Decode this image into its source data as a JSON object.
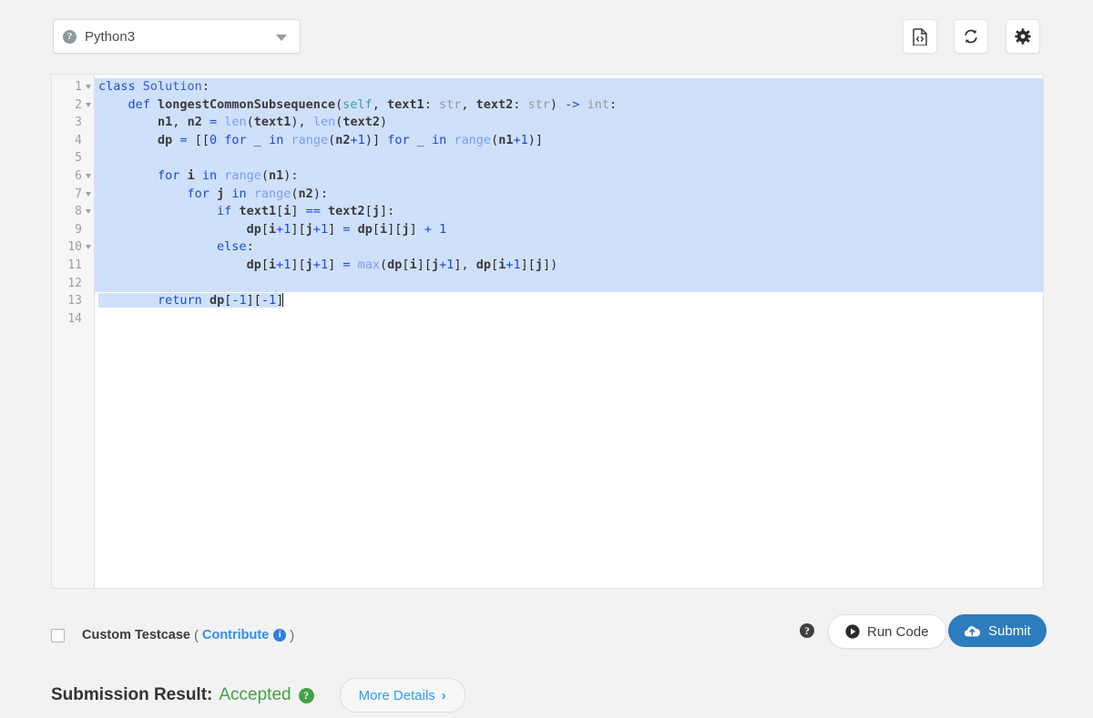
{
  "toolbar": {
    "language": "Python3",
    "language_icon": "help-circle-icon",
    "buttons": [
      {
        "name": "code-snippet-button",
        "icon": "code-file-icon"
      },
      {
        "name": "reset-button",
        "icon": "refresh-icon"
      },
      {
        "name": "settings-button",
        "icon": "gear-icon"
      }
    ]
  },
  "editor": {
    "line_numbers": [
      "1",
      "2",
      "3",
      "4",
      "5",
      "6",
      "7",
      "8",
      "9",
      "10",
      "11",
      "12",
      "13",
      "14"
    ],
    "folded_lines": [
      1,
      2,
      6,
      7,
      8,
      10
    ],
    "selection_color": "#cfe0fb",
    "code_lines": [
      "class Solution:",
      "    def longestCommonSubsequence(self, text1: str, text2: str) -> int:",
      "        n1, n2 = len(text1), len(text2)",
      "        dp = [[0 for _ in range(n2+1)] for _ in range(n1+1)]",
      "",
      "        for i in range(n1):",
      "            for j in range(n2):",
      "                if text1[i] == text2[j]:",
      "                    dp[i+1][j+1] = dp[i][j] + 1",
      "                else:",
      "                    dp[i+1][j+1] = max(dp[i][j+1], dp[i+1][j])",
      "",
      "        return dp[-1][-1]",
      ""
    ]
  },
  "testcase": {
    "checkbox_checked": false,
    "label": "Custom Testcase",
    "open_paren": "(",
    "contribute_label": "Contribute",
    "contribute_icon": "info-icon",
    "close_paren": ")"
  },
  "actions": {
    "help_icon": "help-circle-icon",
    "run_label": "Run Code",
    "run_icon": "play-icon",
    "submit_label": "Submit",
    "submit_icon": "cloud-upload-icon",
    "submit_color": "#2d7cbd"
  },
  "result": {
    "title": "Submission Result:",
    "status": "Accepted",
    "status_color": "#45a247",
    "help_icon": "help-circle-icon",
    "more_details_label": "More Details",
    "more_details_chevron": "›"
  }
}
